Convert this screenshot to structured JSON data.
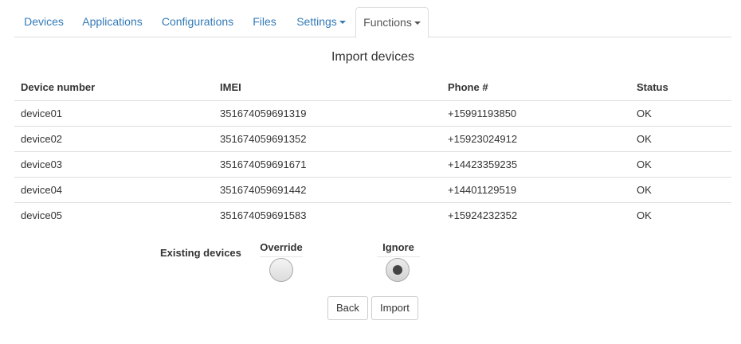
{
  "tabs": [
    {
      "label": "Devices"
    },
    {
      "label": "Applications"
    },
    {
      "label": "Configurations"
    },
    {
      "label": "Files"
    },
    {
      "label": "Settings"
    },
    {
      "label": "Functions"
    }
  ],
  "page": {
    "title": "Import devices"
  },
  "table": {
    "headers": [
      "Device number",
      "IMEI",
      "Phone #",
      "Status"
    ],
    "rows": [
      [
        "device01",
        "351674059691319",
        "+15991193850",
        "OK"
      ],
      [
        "device02",
        "351674059691352",
        "+15923024912",
        "OK"
      ],
      [
        "device03",
        "351674059691671",
        "+14423359235",
        "OK"
      ],
      [
        "device04",
        "351674059691442",
        "+14401129519",
        "OK"
      ],
      [
        "device05",
        "351674059691583",
        "+15924232352",
        "OK"
      ]
    ]
  },
  "existing": {
    "label": "Existing devices",
    "options": [
      {
        "label": "Override",
        "selected": false
      },
      {
        "label": "Ignore",
        "selected": true
      }
    ]
  },
  "buttons": {
    "back": "Back",
    "import": "Import"
  },
  "colors": {
    "link": "#337ab7",
    "active_tab_text": "#555555",
    "border": "#dddddd"
  }
}
